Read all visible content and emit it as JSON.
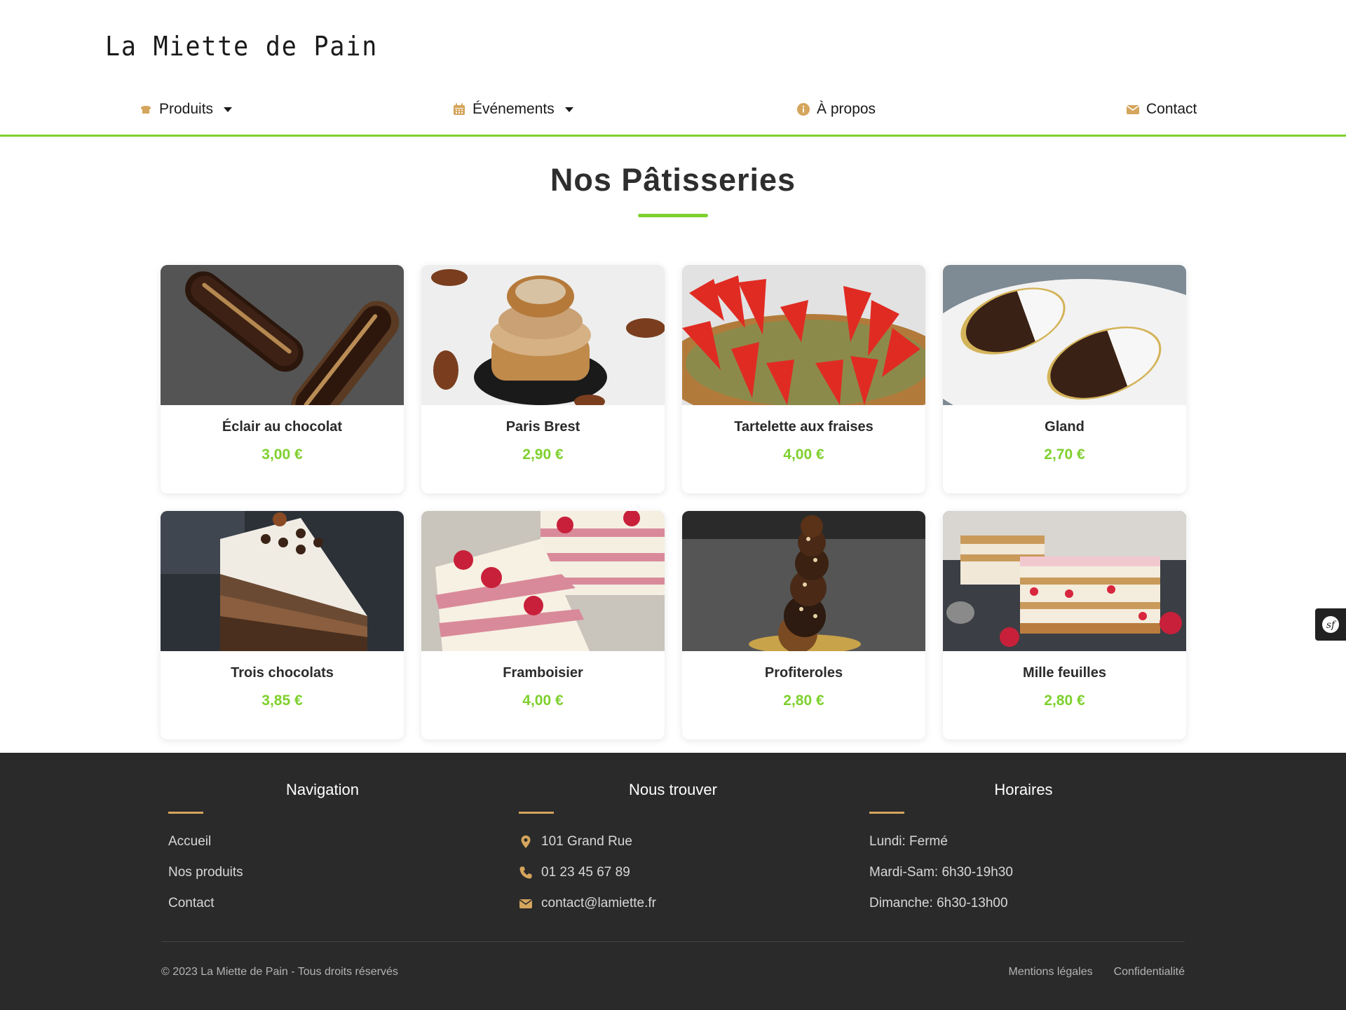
{
  "header": {
    "brand": "La Miette de Pain",
    "nav": [
      {
        "label": "Produits",
        "icon": "bread-icon"
      },
      {
        "label": "Événements",
        "icon": "calendar-icon"
      },
      {
        "label": "À propos",
        "icon": "info-icon"
      },
      {
        "label": "Contact",
        "icon": "envelope-icon"
      }
    ]
  },
  "main": {
    "title": "Nos Pâtisseries",
    "products": [
      {
        "name": "Éclair au chocolat",
        "price": "3,00 €"
      },
      {
        "name": "Paris Brest",
        "price": "2,90 €"
      },
      {
        "name": "Tartelette aux fraises",
        "price": "4,00 €"
      },
      {
        "name": "Gland",
        "price": "2,70 €"
      },
      {
        "name": "Trois chocolats",
        "price": "3,85 €"
      },
      {
        "name": "Framboisier",
        "price": "4,00 €"
      },
      {
        "name": "Profiteroles",
        "price": "2,80 €"
      },
      {
        "name": "Mille feuilles",
        "price": "2,80 €"
      }
    ]
  },
  "footer": {
    "navigation": {
      "title": "Navigation",
      "links": [
        "Accueil",
        "Nos produits",
        "Contact"
      ]
    },
    "find_us": {
      "title": "Nous trouver",
      "address": "101 Grand Rue",
      "phone": "01 23 45 67 89",
      "email": "contact@lamiette.fr"
    },
    "hours": {
      "title": "Horaires",
      "lines": [
        "Lundi: Fermé",
        "Mardi-Sam: 6h30-19h30",
        "Dimanche: 6h30-13h00"
      ]
    },
    "copyright": "© 2023 La Miette de Pain - Tous droits réservés",
    "legal_links": [
      "Mentions légales",
      "Confidentialité"
    ]
  },
  "colors": {
    "accent_green": "#7ed02e",
    "icon_gold": "#d4a55c",
    "footer_bg": "#2a2a2a"
  }
}
